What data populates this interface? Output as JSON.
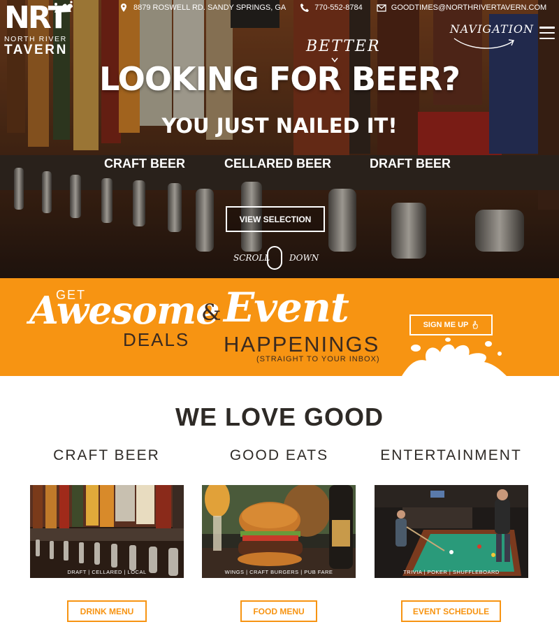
{
  "topbar": {
    "address": "8879 ROSWELL RD. SANDY SPRINGS, GA",
    "phone": "770-552-8784",
    "email": "GOODTIMES@NORTHRIVERTAVERN.COM"
  },
  "logo": {
    "mark": "NRT",
    "line1": "NORTH RIVER",
    "line2": "TAVERN"
  },
  "nav": {
    "label": "NAVIGATION"
  },
  "hero": {
    "headline": "LOOKING FOR BEER?",
    "better": "BETTER",
    "subhead": "YOU JUST NAILED IT!",
    "types": [
      "CRAFT BEER",
      "CELLARED BEER",
      "DRAFT BEER"
    ],
    "view_button": "VIEW SELECTION",
    "scroll_left": "SCROLL",
    "scroll_right": "DOWN"
  },
  "banner": {
    "get": "GET",
    "awesome": "Awesome",
    "deals": "DEALS",
    "amp": "&",
    "event": "Event",
    "happenings": "HAPPENINGS",
    "inbox": "(STRAIGHT TO YOUR INBOX)",
    "signup": "SIGN ME UP",
    "signup_icon": "hand-icon",
    "accent_color": "#f79412"
  },
  "love": {
    "title": "WE LOVE GOOD",
    "categories": [
      {
        "title": "CRAFT BEER",
        "caption": "DRAFT | CELLARED | LOCAL",
        "button": "DRINK MENU"
      },
      {
        "title": "GOOD EATS",
        "caption": "WINGS | CRAFT BURGERS | PUB FARE",
        "button": "FOOD MENU"
      },
      {
        "title": "ENTERTAINMENT",
        "caption": "TRIVIA | POKER | SHUFFLEBOARD",
        "button": "EVENT SCHEDULE"
      }
    ]
  }
}
